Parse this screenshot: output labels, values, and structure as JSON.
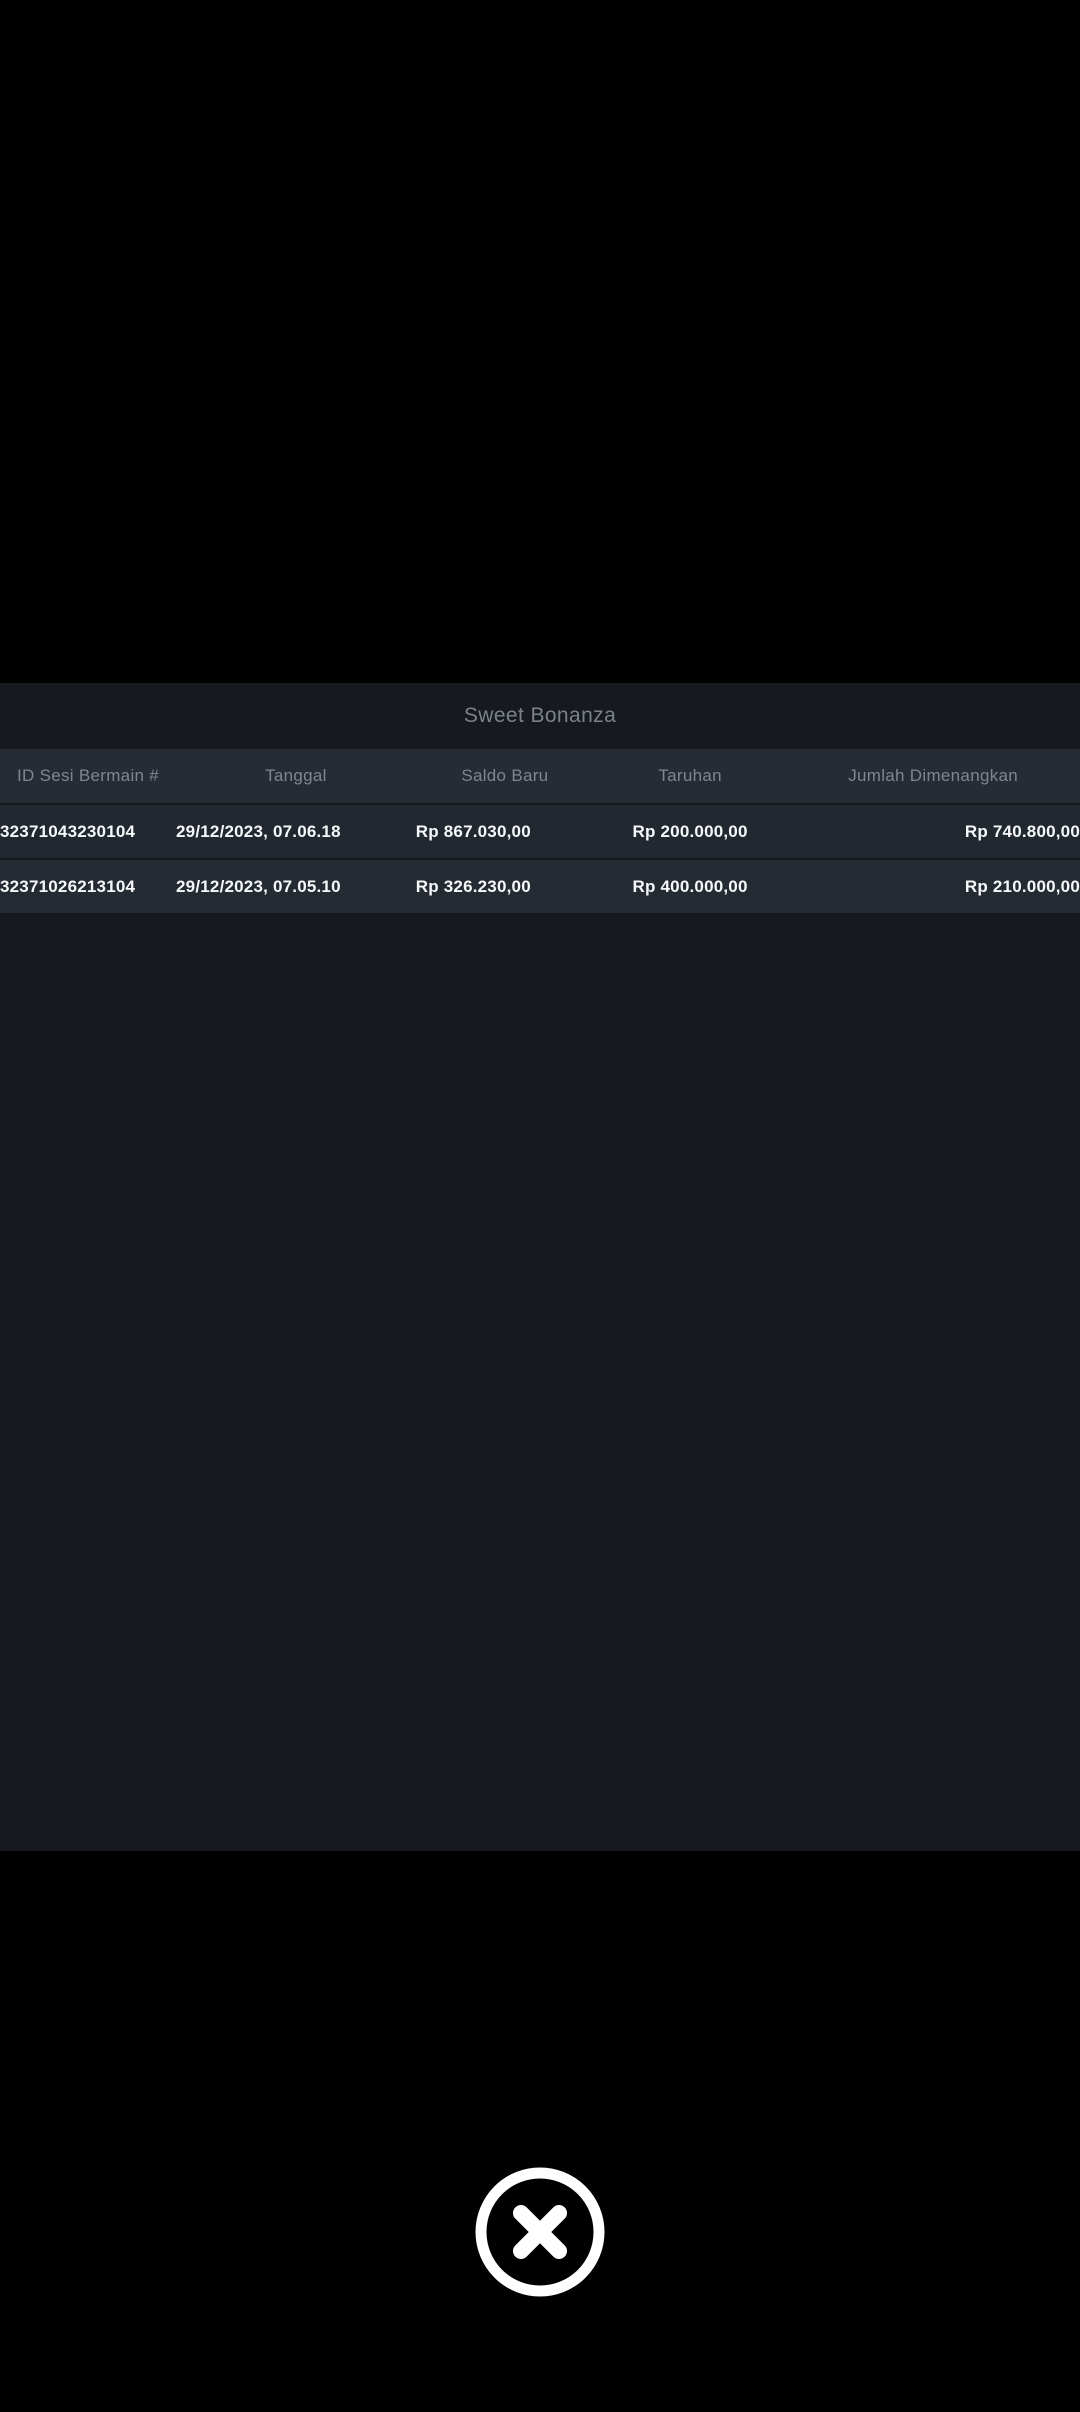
{
  "modal": {
    "title": "Sweet Bonanza",
    "table": {
      "columns": {
        "id": "ID Sesi Bermain #",
        "date": "Tanggal",
        "balance": "Saldo Baru",
        "bet": "Taruhan",
        "win": "Jumlah Dimenangkan"
      },
      "rows": [
        {
          "id": "32371043230104",
          "date": "29/12/2023, 07.06.18",
          "balance": "Rp 867.030,00",
          "bet": "Rp 200.000,00",
          "win": "Rp 740.800,00"
        },
        {
          "id": "32371026213104",
          "date": "29/12/2023, 07.05.10",
          "balance": "Rp 326.230,00",
          "bet": "Rp 400.000,00",
          "win": "Rp 210.000,00"
        }
      ]
    }
  },
  "close_button": {
    "label": "close"
  },
  "colors": {
    "screen_bg": "#000000",
    "panel_bg": "#16191e",
    "header_bg": "#252c33",
    "row_odd_bg": "#212830",
    "row_even_bg": "#242b33",
    "separator": "#14171b",
    "header_text": "#7e868f",
    "muted_id_text": "#6d757e",
    "value_text": "#f7f8f9",
    "title_text": "#7a828b",
    "close_icon": "#ffffff"
  }
}
